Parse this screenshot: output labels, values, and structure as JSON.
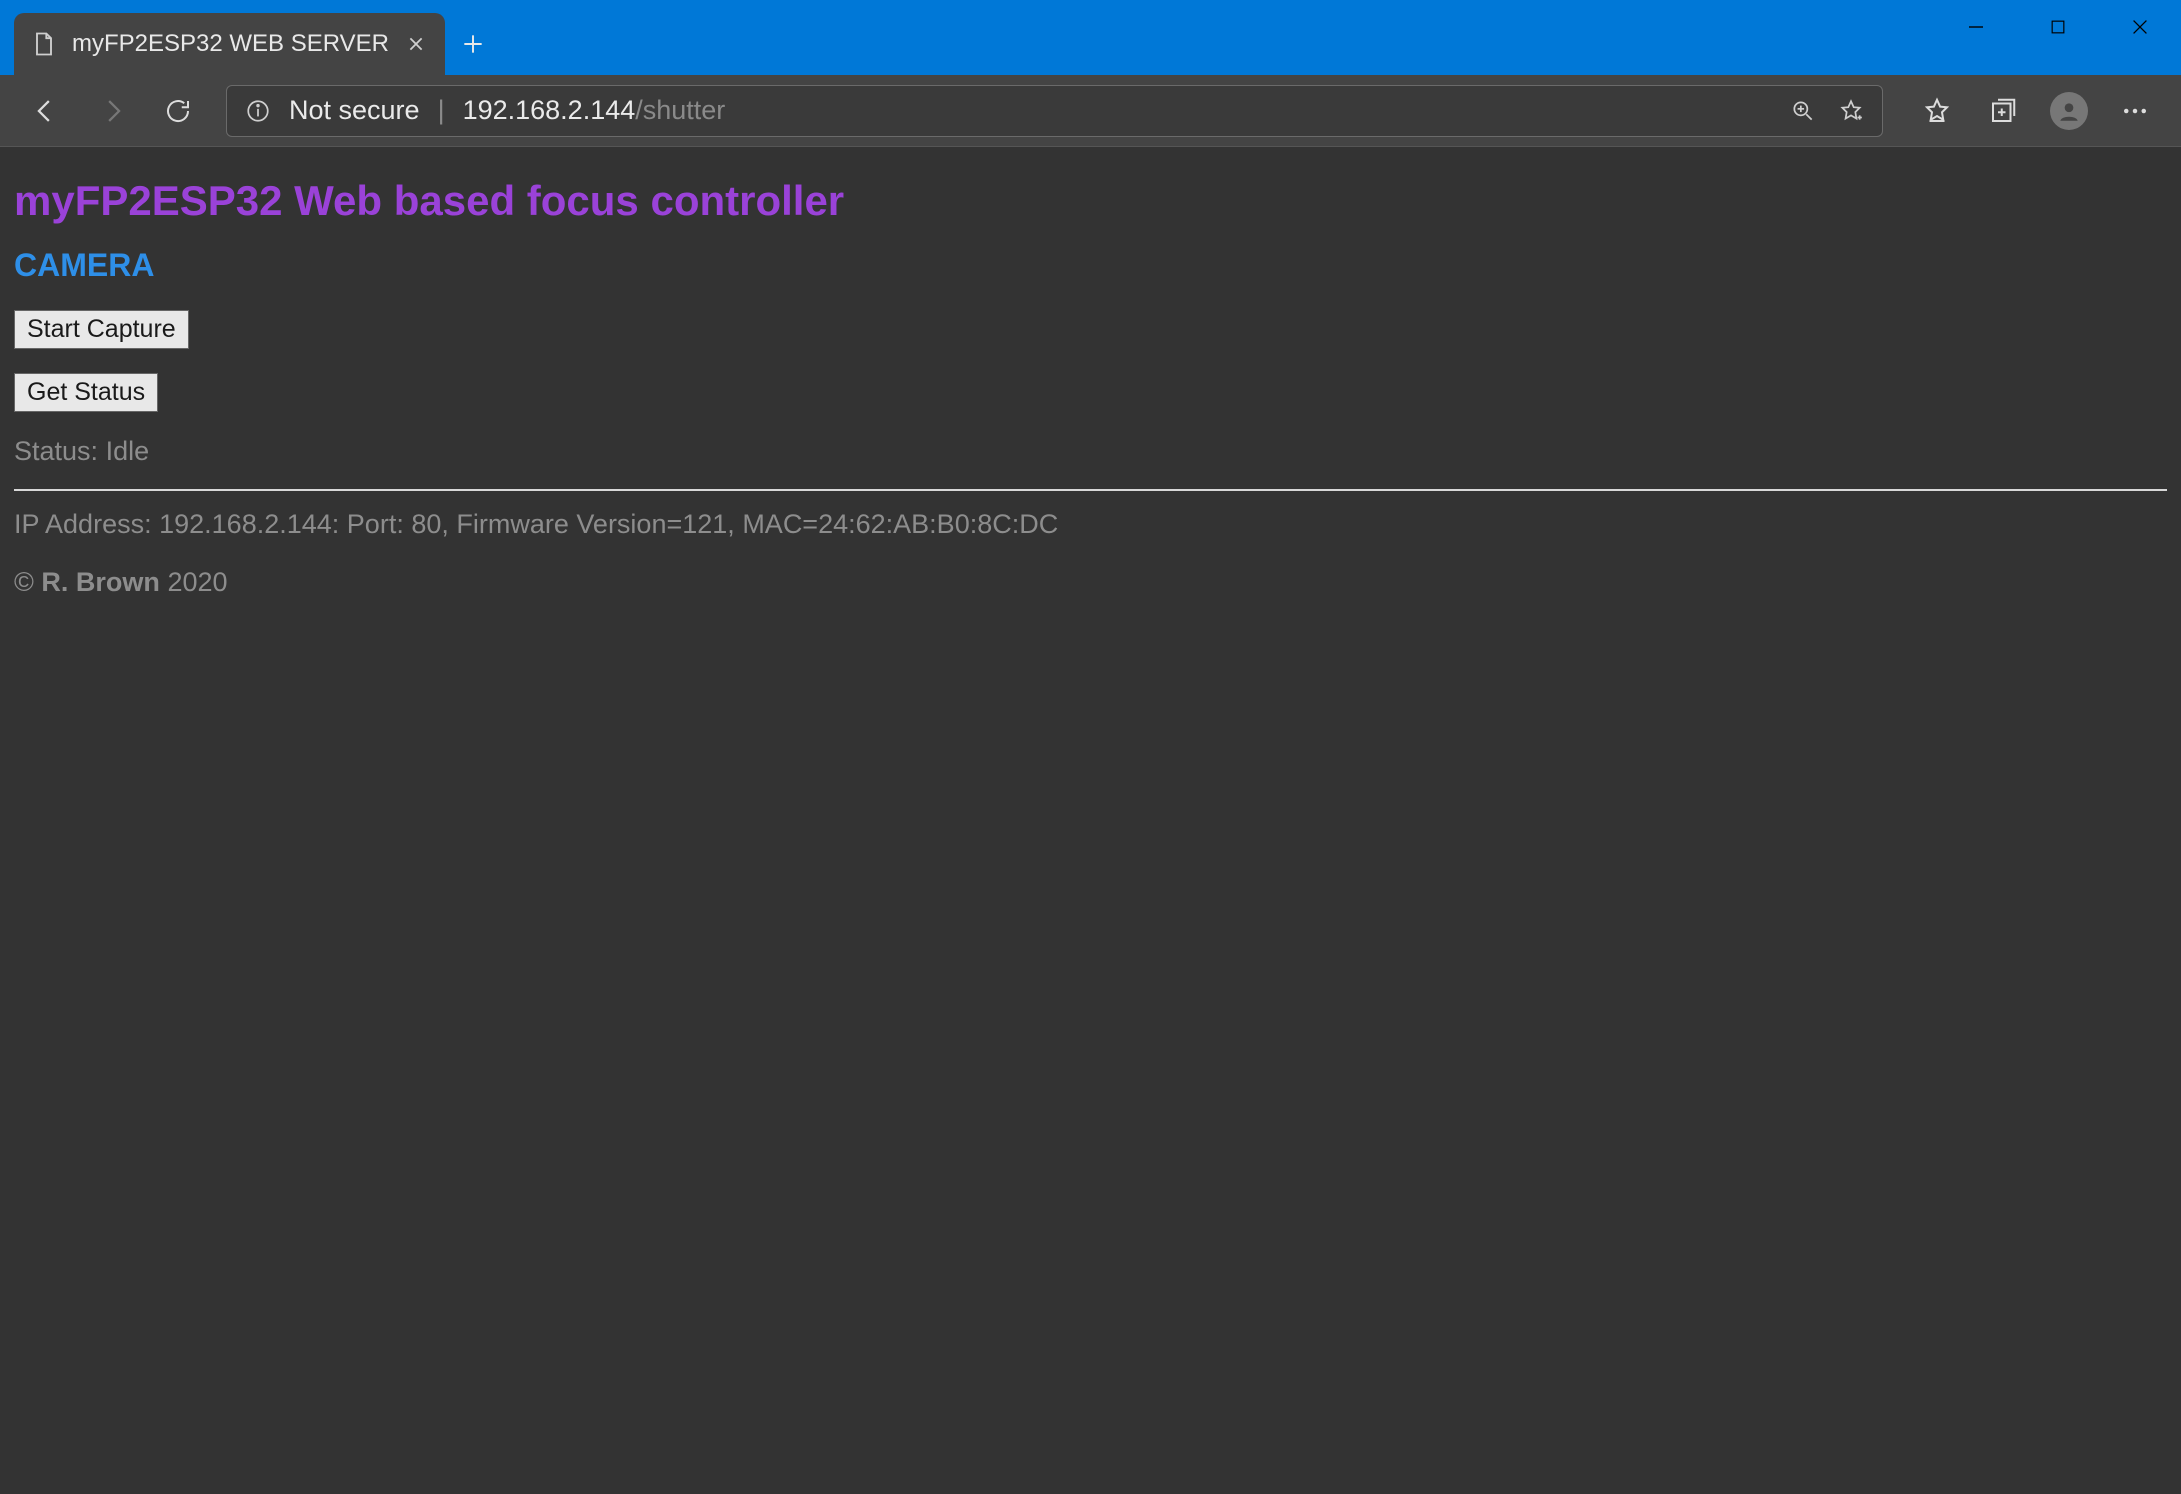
{
  "window": {
    "tab_title": "myFP2ESP32 WEB SERVER"
  },
  "address_bar": {
    "security_label": "Not secure",
    "host": "192.168.2.144",
    "path": "/shutter"
  },
  "page": {
    "heading": "myFP2ESP32 Web based focus controller",
    "section_title": "CAMERA",
    "buttons": {
      "start_capture": "Start Capture",
      "get_status": "Get Status"
    },
    "status_label": "Status:",
    "status_value": "Idle",
    "footer": {
      "ip_label": "IP Address:",
      "ip": "192.168.2.144",
      "port_label": "Port:",
      "port": "80",
      "fw_label": "Firmware Version=",
      "fw": "121",
      "mac_label": "MAC=",
      "mac": "24:62:AB:B0:8C:DC"
    },
    "copyright": {
      "symbol": "©",
      "author": "R. Brown",
      "year": "2020"
    }
  }
}
